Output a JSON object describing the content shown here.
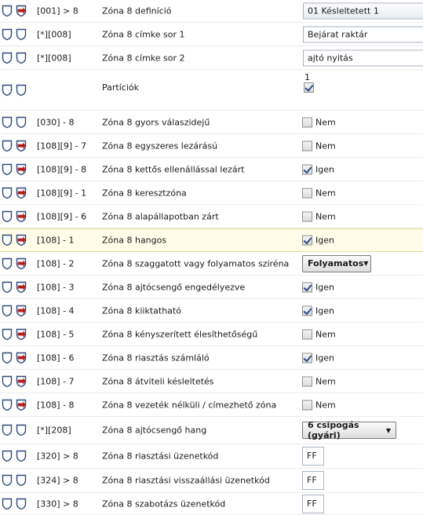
{
  "rows": [
    {
      "code": "[001] > 8",
      "label": "Zóna 8 definíció",
      "control": "select",
      "value": "01 Késleltetett 1",
      "arrow": "red"
    },
    {
      "code": "[*][008]",
      "label": "Zóna 8 címke sor 1",
      "control": "text",
      "value": "Bejárat raktár",
      "arrow": "none"
    },
    {
      "code": "[*][008]",
      "label": "Zóna 8 címke sor 2",
      "control": "text",
      "value": "ajtó nyitás",
      "arrow": "none"
    },
    {
      "code": "",
      "label": "Partíciók",
      "control": "partition",
      "value": "1",
      "checked": true,
      "arrow": "none"
    },
    {
      "code": "[030] - 8",
      "label": "Zóna 8 gyors válaszidejű",
      "control": "check",
      "value": "Nem",
      "checked": false,
      "arrow": "none"
    },
    {
      "code": "[108][9] - 7",
      "label": "Zóna 8 egyszeres lezárású",
      "control": "check",
      "value": "Nem",
      "checked": false,
      "arrow": "red"
    },
    {
      "code": "[108][9] - 8",
      "label": "Zóna 8 kettős ellenállással lezárt",
      "control": "check",
      "value": "Igen",
      "checked": true,
      "arrow": "red"
    },
    {
      "code": "[108][9] - 1",
      "label": "Zóna 8 keresztzóna",
      "control": "check",
      "value": "Nem",
      "checked": false,
      "arrow": "red"
    },
    {
      "code": "[108][9] - 6",
      "label": "Zóna 8 alapállapotban zárt",
      "control": "check",
      "value": "Nem",
      "checked": false,
      "arrow": "red"
    },
    {
      "code": "[108] - 1",
      "label": "Zóna 8 hangos",
      "control": "check",
      "value": "Igen",
      "checked": true,
      "arrow": "red",
      "highlight": true
    },
    {
      "code": "[108] - 2",
      "label": "Zóna 8 szaggatott vagy folyamatos sziréna",
      "control": "dropdown",
      "value": "Folyamatos",
      "arrow": "red"
    },
    {
      "code": "[108] - 3",
      "label": "Zóna 8 ajtócsengő engedélyezve",
      "control": "check",
      "value": "Igen",
      "checked": true,
      "arrow": "red"
    },
    {
      "code": "[108] - 4",
      "label": "Zóna 8 kiiktatható",
      "control": "check",
      "value": "Igen",
      "checked": true,
      "arrow": "red"
    },
    {
      "code": "[108] - 5",
      "label": "Zóna 8 kényszerített élesíthetőségű",
      "control": "check",
      "value": "Nem",
      "checked": false,
      "arrow": "red"
    },
    {
      "code": "[108] - 6",
      "label": "Zóna 8 riasztás számláló",
      "control": "check",
      "value": "Igen",
      "checked": true,
      "arrow": "red"
    },
    {
      "code": "[108] - 7",
      "label": "Zóna 8 átviteli késleltetés",
      "control": "check",
      "value": "Nem",
      "checked": false,
      "arrow": "red"
    },
    {
      "code": "[108] - 8",
      "label": "Zóna 8 vezeték nélküli / címezhető zóna",
      "control": "check",
      "value": "Nem",
      "checked": false,
      "arrow": "red"
    },
    {
      "code": "[*][208]",
      "label": "Zóna 8 ajtócsengő hang",
      "control": "dropdown",
      "value": "6 csipogás (gyári)",
      "arrow": "none"
    },
    {
      "code": "[320] > 8",
      "label": "Zóna 8 riasztási üzenetkód",
      "control": "small",
      "value": "FF",
      "arrow": "none"
    },
    {
      "code": "[324] > 8",
      "label": "Zóna 8 riasztási visszaállási üzenetkód",
      "control": "small",
      "value": "FF",
      "arrow": "none"
    },
    {
      "code": "[330] > 8",
      "label": "Zóna 8 szabotázs üzenetkód",
      "control": "small",
      "value": "FF",
      "arrow": "none"
    }
  ],
  "colors": {
    "shield": "#2e4a7a",
    "arrow_red": "#b31b1b",
    "highlight_bg": "#fffde8"
  },
  "icons": {
    "left": "shield-icon",
    "right": "shield-arrow-icon"
  }
}
